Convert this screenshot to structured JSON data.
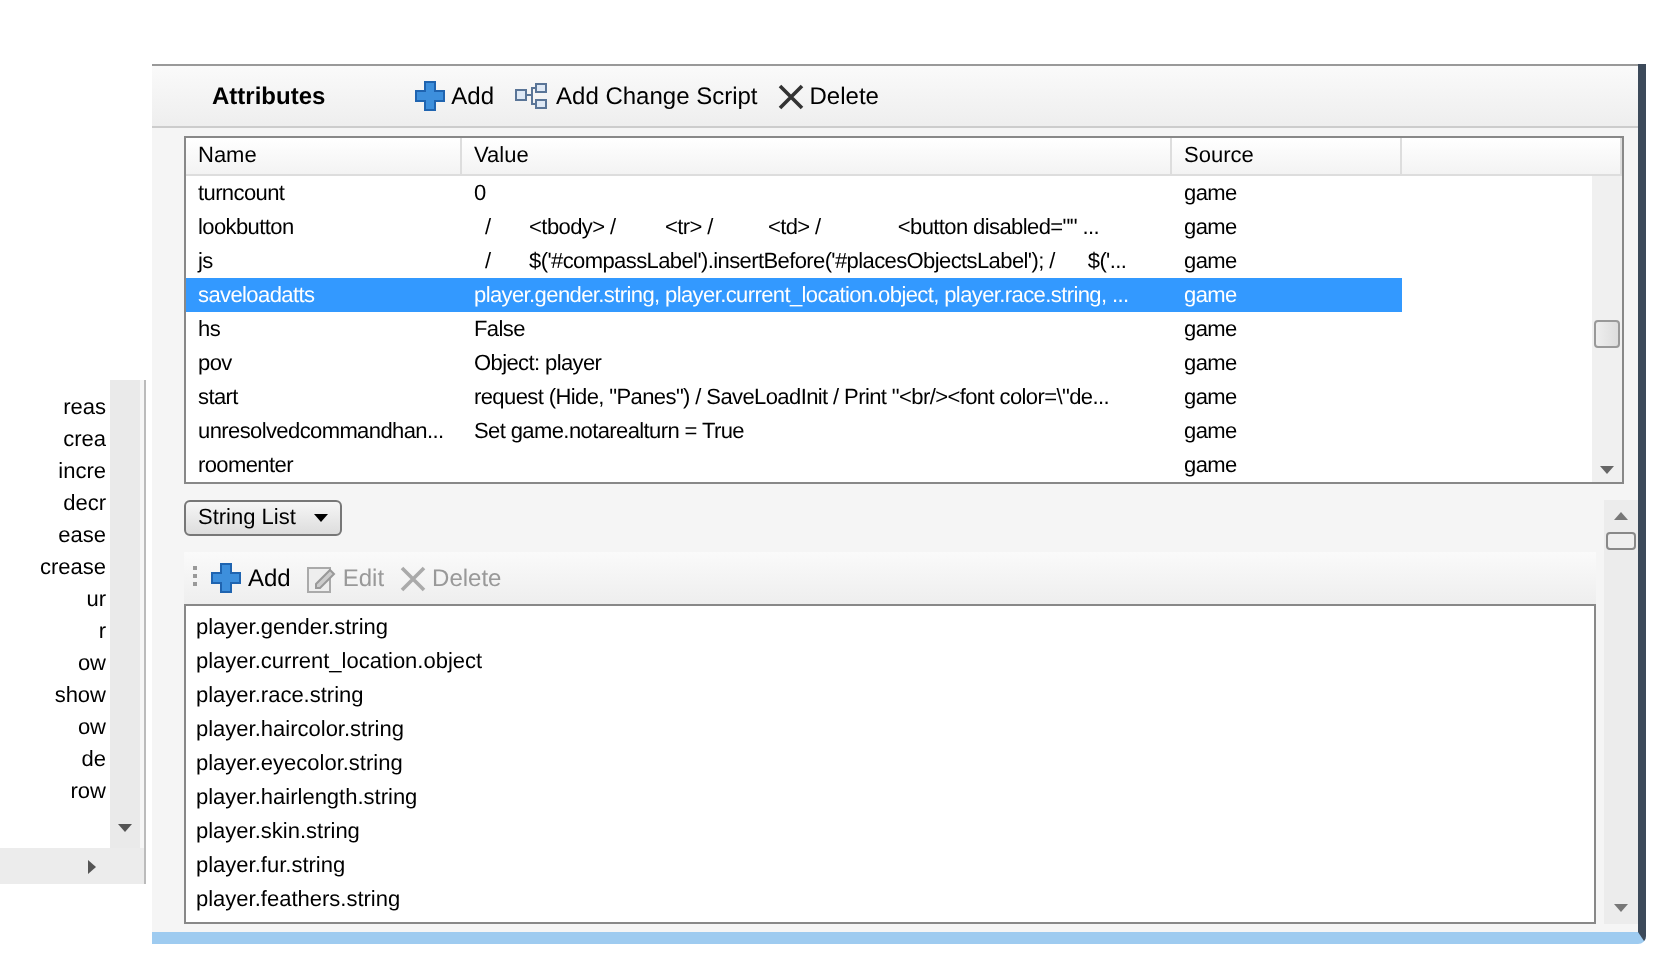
{
  "tree": {
    "items": [
      "reas",
      "crea",
      "incre",
      "decr",
      "ease",
      "crease",
      "ur",
      "r",
      "ow",
      "show",
      "ow",
      "de",
      "row"
    ]
  },
  "attributes_panel": {
    "title": "Attributes",
    "toolbar": [
      {
        "kind": "add",
        "label": "Add",
        "disabled": false
      },
      {
        "kind": "script",
        "label": "Add Change Script",
        "disabled": false
      },
      {
        "kind": "delete",
        "label": "Delete",
        "disabled": false
      }
    ]
  },
  "attributes_table": {
    "columns": [
      "Name",
      "Value",
      "Source"
    ],
    "rows": [
      {
        "name": "turncount",
        "value": "0",
        "source": "game",
        "selected": false
      },
      {
        "name": "lookbutton",
        "value": "  /       <tbody> /         <tr> /          <td> /              <button disabled=\"\" ...",
        "source": "game",
        "selected": false
      },
      {
        "name": "js",
        "value": "  /       $('#compassLabel').insertBefore('#placesObjectsLabel'); /      $('...",
        "source": "game",
        "selected": false
      },
      {
        "name": "saveloadatts",
        "value": "player.gender.string, player.current_location.object, player.race.string, ...",
        "source": "game",
        "selected": true
      },
      {
        "name": "hs",
        "value": "False",
        "source": "game",
        "selected": false
      },
      {
        "name": "pov",
        "value": "Object: player",
        "source": "game",
        "selected": false
      },
      {
        "name": "start",
        "value": "request (Hide, \"Panes\") / SaveLoadInit / Print \"<br/><font color=\\\"de...",
        "source": "game",
        "selected": false
      },
      {
        "name": "unresolvedcommandhan...",
        "value": "Set game.notarealturn = True",
        "source": "game",
        "selected": false
      },
      {
        "name": "roomenter",
        "value": "",
        "source": "game",
        "selected": false
      }
    ]
  },
  "type_dropdown": {
    "value": "String List"
  },
  "list_toolbar": [
    {
      "kind": "add",
      "label": "Add",
      "disabled": false
    },
    {
      "kind": "edit",
      "label": "Edit",
      "disabled": true
    },
    {
      "kind": "delete",
      "label": "Delete",
      "disabled": true
    }
  ],
  "string_list": {
    "items": [
      "player.gender.string",
      "player.current_location.object",
      "player.race.string",
      "player.haircolor.string",
      "player.eyecolor.string",
      "player.hairlength.string",
      "player.skin.string",
      "player.fur.string",
      "player.feathers.string"
    ]
  }
}
